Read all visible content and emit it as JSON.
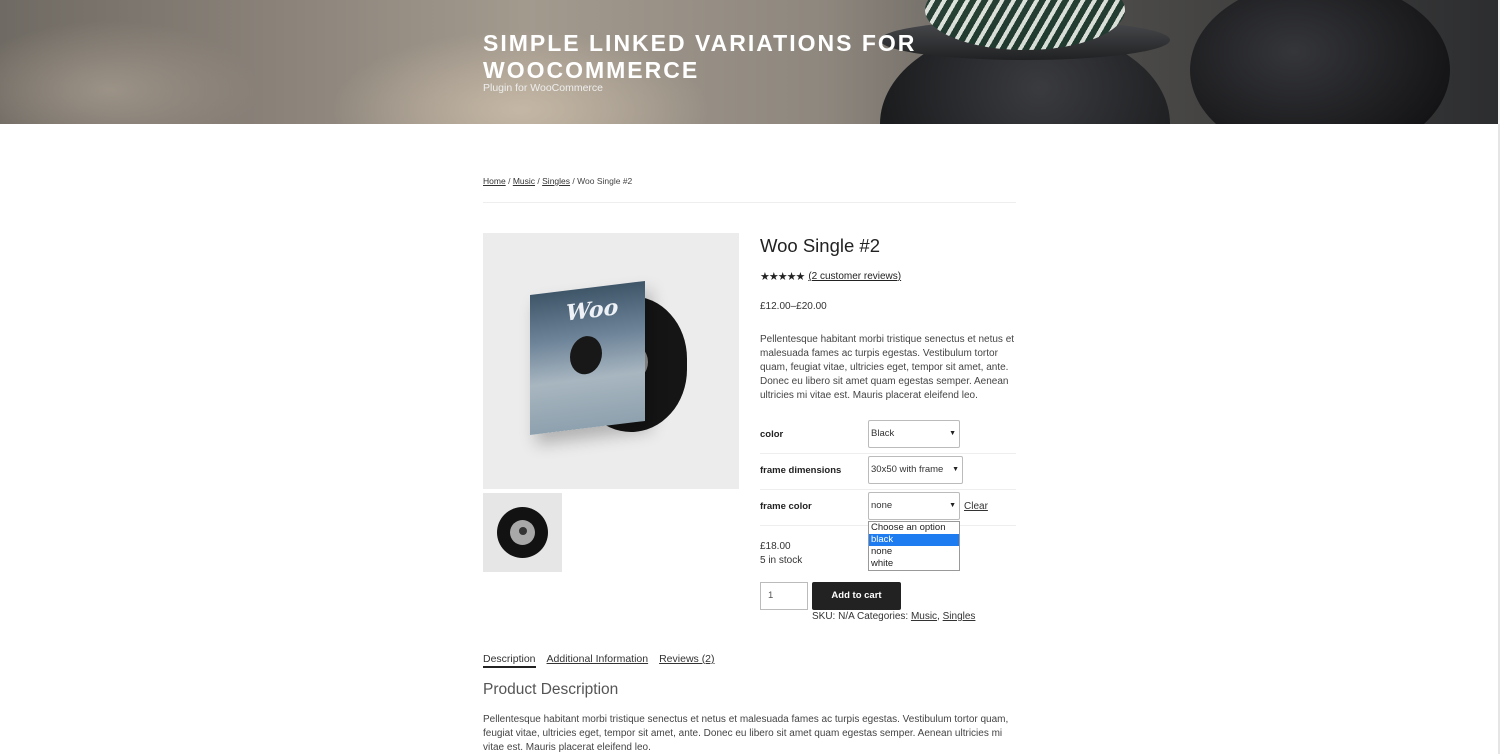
{
  "site": {
    "title": "SIMPLE LINKED VARIATIONS FOR WOOCOMMERCE",
    "description": "Plugin for WooCommerce"
  },
  "breadcrumb": {
    "items": [
      "Home",
      "Music",
      "Singles"
    ],
    "separator": "/",
    "current": "Woo Single #2"
  },
  "product": {
    "title": "Woo Single #2",
    "rating_stars": "★★★★★",
    "rating_value": 4.5,
    "reviews_link": "(2 customer reviews)",
    "price_range": "£12.00–£20.00",
    "short_description": "Pellentesque habitant morbi tristique senectus et netus et malesuada fames ac turpis egestas. Vestibulum tortor quam, feugiat vitae, ultricies eget, tempor sit amet, ante. Donec eu libero sit amet quam egestas semper. Aenean ultricies mi vitae est. Mauris placerat eleifend leo.",
    "image_sleeve_text": "Woo"
  },
  "variations": [
    {
      "label": "color",
      "value": "Black"
    },
    {
      "label": "frame dimensions",
      "value": "30x50 with frame"
    },
    {
      "label": "frame color",
      "value": "none"
    }
  ],
  "clear_label": "Clear",
  "dropdown": {
    "options": [
      "Choose an option",
      "black",
      "none",
      "white"
    ],
    "highlighted": "black"
  },
  "variation_price": "£18.00",
  "stock": "5 in stock",
  "quantity": "1",
  "add_to_cart": "Add to cart",
  "meta": {
    "sku": "SKU: N/A Categories:",
    "categories": [
      "Music",
      "Singles"
    ],
    "category_separator": ","
  },
  "tabs": [
    "Description",
    "Additional Information",
    "Reviews (2)"
  ],
  "product_description": {
    "title": "Product Description",
    "text": "Pellentesque habitant morbi tristique senectus et netus et malesuada fames ac turpis egestas. Vestibulum tortor quam, feugiat vitae, ultricies eget, tempor sit amet, ante. Donec eu libero sit amet quam egestas semper. Aenean ultricies mi vitae est. Mauris placerat eleifend leo."
  },
  "colors": {
    "button_bg": "#222222",
    "dropdown_highlight": "#1e7cf0",
    "text": "#333333"
  }
}
